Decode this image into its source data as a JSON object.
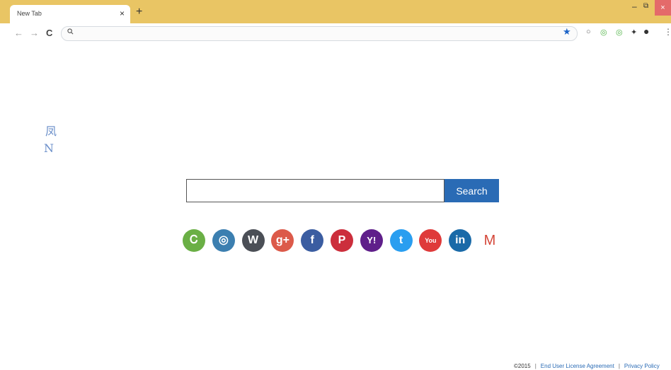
{
  "tab": {
    "title": "New Tab",
    "close_glyph": "×",
    "new_tab_glyph": "+"
  },
  "window_controls": {
    "minimize": "–",
    "maximize": "⧉",
    "close": "×"
  },
  "toolbar": {
    "back_glyph": "←",
    "forward_glyph": "→",
    "reload_glyph": "C",
    "omnibox_value": "",
    "icons": [
      "search-icon",
      "star-icon",
      "extension-icon",
      "profile-icon",
      "menu-icon"
    ]
  },
  "search": {
    "button_label": "Search",
    "input_value": ""
  },
  "socials": [
    {
      "name": "custom-site",
      "glyph": "Ꮯ",
      "color": "#6aaf45"
    },
    {
      "name": "instagram",
      "glyph": "◎",
      "color": "#3c7fb0"
    },
    {
      "name": "wikipedia",
      "glyph": "W",
      "color": "#4b4f56"
    },
    {
      "name": "google-plus",
      "glyph": "g+",
      "color": "#dc5a4a"
    },
    {
      "name": "facebook",
      "glyph": "f",
      "color": "#3b5da1"
    },
    {
      "name": "pinterest",
      "glyph": "P",
      "color": "#cc2e3c"
    },
    {
      "name": "yahoo",
      "glyph": "Y!",
      "color": "#5f1f8a"
    },
    {
      "name": "twitter",
      "glyph": "t",
      "color": "#2a9ef0"
    },
    {
      "name": "youtube",
      "glyph": "You",
      "color": "#df3a3a"
    },
    {
      "name": "linkedin",
      "glyph": "in",
      "color": "#1a6aa8"
    },
    {
      "name": "gmail",
      "glyph": "M",
      "color": "#ffffff"
    }
  ],
  "footer": {
    "copyright": "©2015",
    "sep": "|",
    "eula": "End User License Agreement",
    "privacy": "Privacy Policy"
  },
  "stray_marks": [
    "凤",
    "N"
  ],
  "colors": {
    "tabstrip": "#e9c564",
    "search_button": "#2a6bb5",
    "close_button": "#e46a6a"
  }
}
